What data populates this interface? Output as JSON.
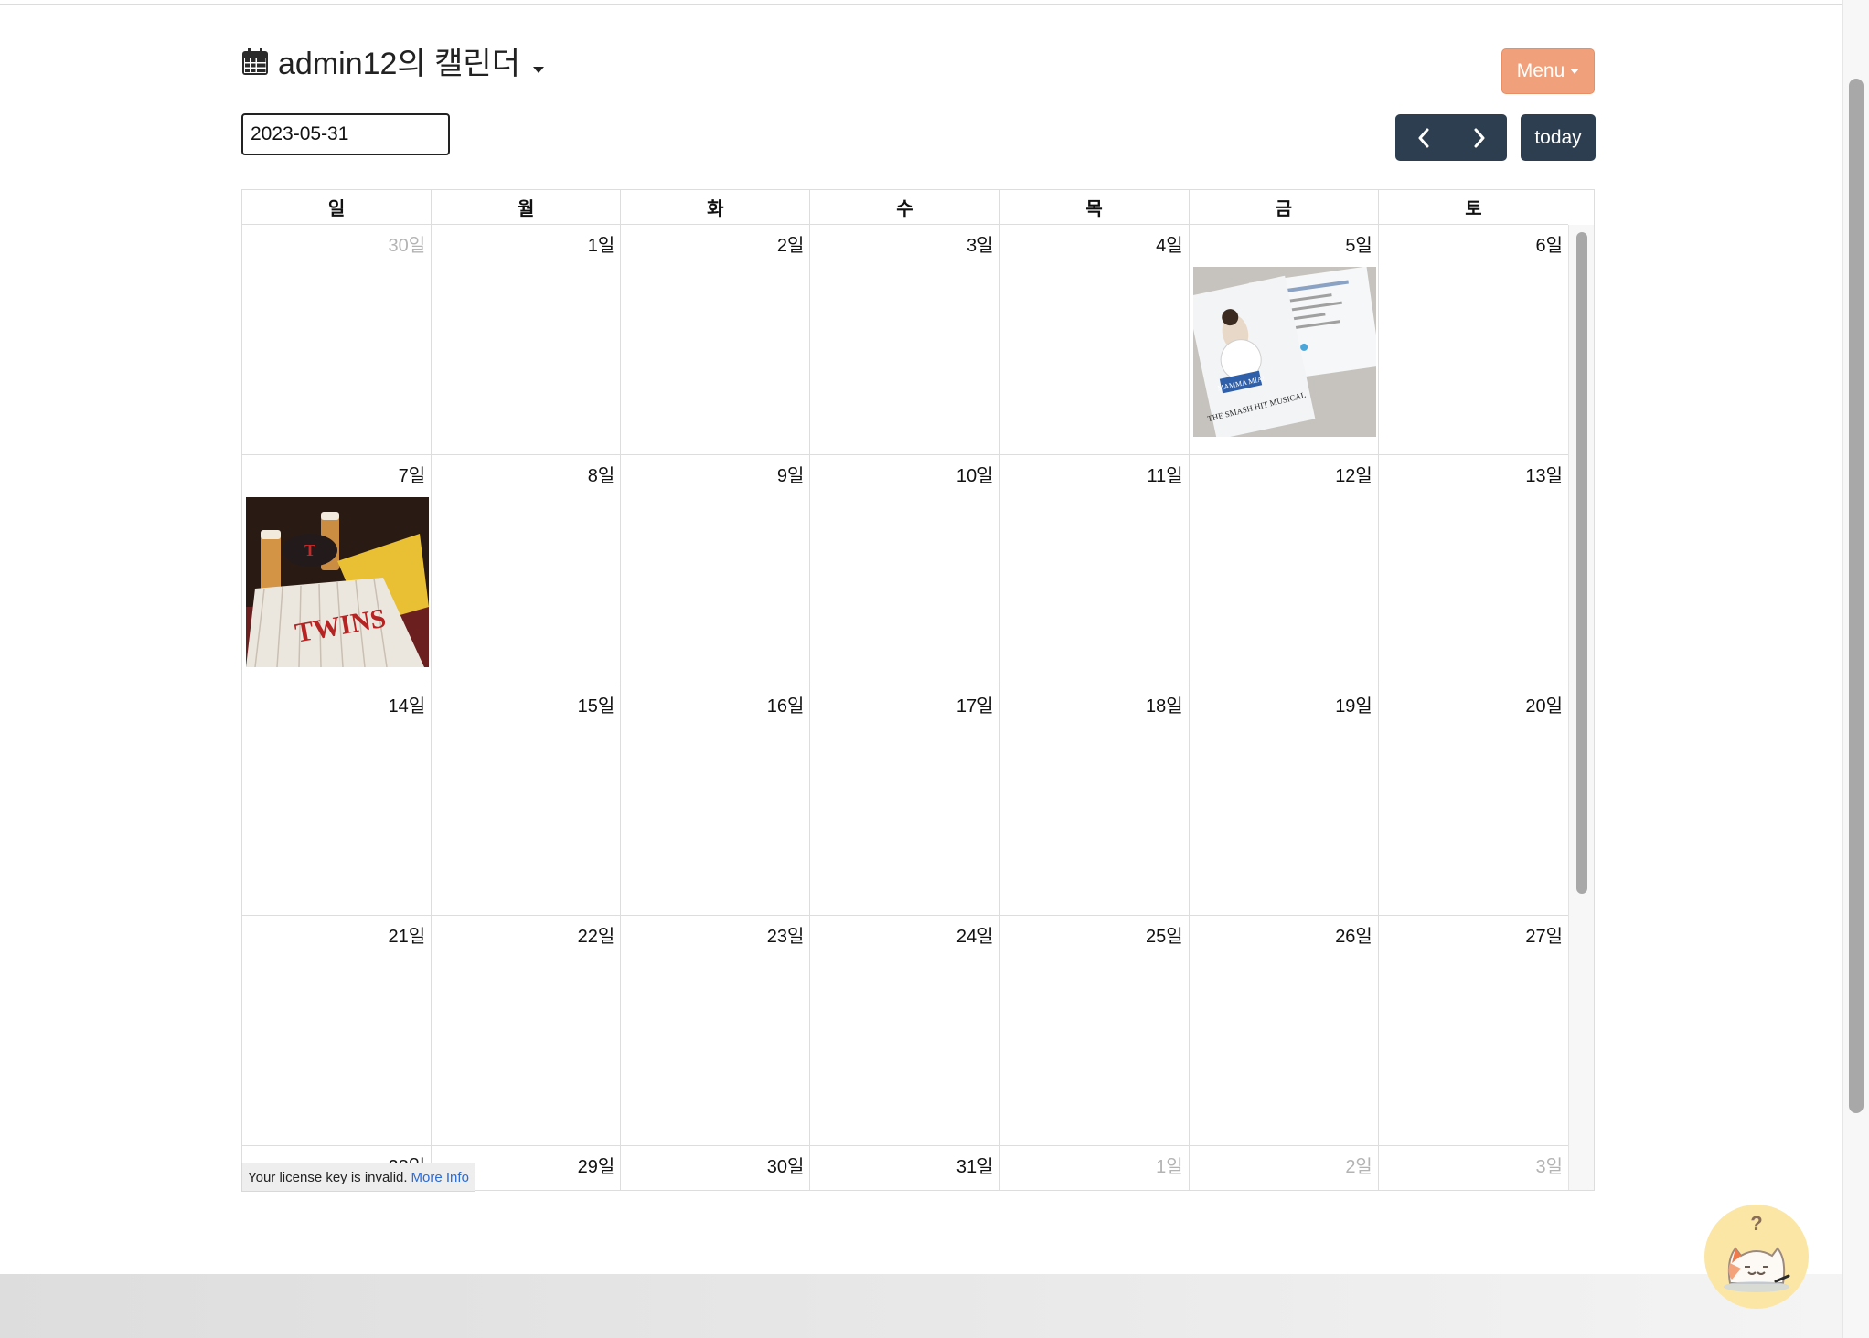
{
  "title": {
    "text": "admin12의 캘린더",
    "icon": "calendar-icon"
  },
  "menu_button": {
    "label": "Menu",
    "color": "#f0a07a"
  },
  "date_input": {
    "value": "2023-05-31"
  },
  "nav": {
    "prev_icon": "chevron-left-icon",
    "next_icon": "chevron-right-icon",
    "today_label": "today",
    "color": "#2c3e50"
  },
  "weekdays": [
    "일",
    "월",
    "화",
    "수",
    "목",
    "금",
    "토"
  ],
  "weeks": [
    [
      {
        "label": "30일",
        "other": true
      },
      {
        "label": "1일"
      },
      {
        "label": "2일"
      },
      {
        "label": "3일"
      },
      {
        "label": "4일"
      },
      {
        "label": "5일",
        "photo": "ticket-photo"
      },
      {
        "label": "6일"
      }
    ],
    [
      {
        "label": "7일",
        "photo": "twins-photo"
      },
      {
        "label": "8일"
      },
      {
        "label": "9일"
      },
      {
        "label": "10일"
      },
      {
        "label": "11일"
      },
      {
        "label": "12일"
      },
      {
        "label": "13일"
      }
    ],
    [
      {
        "label": "14일"
      },
      {
        "label": "15일"
      },
      {
        "label": "16일"
      },
      {
        "label": "17일"
      },
      {
        "label": "18일"
      },
      {
        "label": "19일"
      },
      {
        "label": "20일"
      }
    ],
    [
      {
        "label": "21일"
      },
      {
        "label": "22일"
      },
      {
        "label": "23일"
      },
      {
        "label": "24일"
      },
      {
        "label": "25일"
      },
      {
        "label": "26일"
      },
      {
        "label": "27일"
      }
    ],
    [
      {
        "label": "28일"
      },
      {
        "label": "29일"
      },
      {
        "label": "30일"
      },
      {
        "label": "31일"
      },
      {
        "label": "1일",
        "other": true
      },
      {
        "label": "2일",
        "other": true
      },
      {
        "label": "3일",
        "other": true
      }
    ]
  ],
  "photos": {
    "ticket": {
      "lines": [
        "MAMMA MIA!",
        "THE SMASH HIT MUSICAL"
      ]
    },
    "twins": {
      "lines": [
        "TWINS"
      ]
    }
  },
  "license": {
    "text": "Your license key is invalid.",
    "link": "More Info"
  },
  "help": {
    "icon": "cat-help-icon",
    "symbol": "?"
  }
}
